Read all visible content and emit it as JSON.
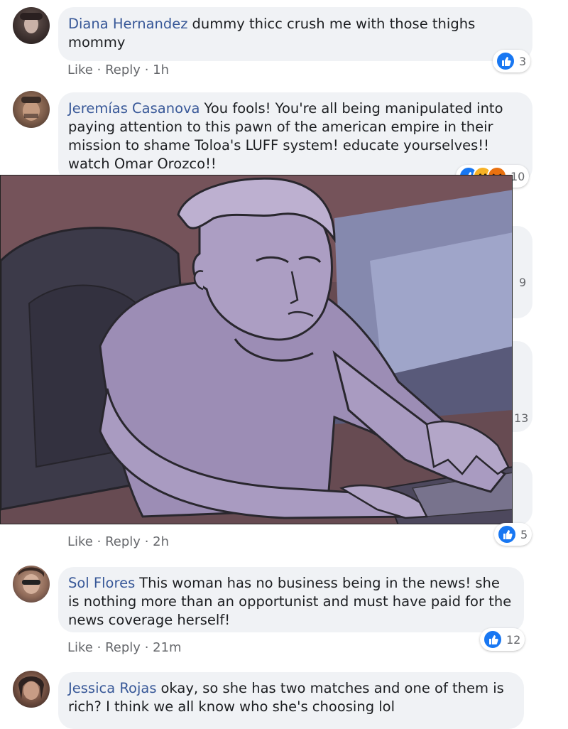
{
  "comments": [
    {
      "author": "Diana Hernandez",
      "text": "dummy thicc crush me with those thighs mommy",
      "like_label": "Like",
      "reply_label": "Reply",
      "time": "1h",
      "reaction_count": "3",
      "reaction_icons": [
        "like-icon"
      ]
    },
    {
      "author": "Jeremías Casanova",
      "text": "You fools! You're all being manipulated into paying attention to this pawn of the american empire in their mission to shame Toloa's LUFF system! educate yourselves!! watch Omar Orozco!!",
      "reaction_count": "10",
      "reaction_icons": [
        "like-icon",
        "sad-icon",
        "angry-icon"
      ]
    },
    {
      "like_label": "Like",
      "reply_label": "Reply",
      "time": "2h",
      "reaction_count": "5",
      "reaction_icons": [
        "like-icon"
      ],
      "partially_visible_counts": [
        "9",
        "13"
      ]
    },
    {
      "author": "Sol Flores",
      "text": "This woman has no business being in the news! she is nothing more than an opportunist and must have paid for the news coverage herself!",
      "like_label": "Like",
      "reply_label": "Reply",
      "time": "21m",
      "reaction_count": "12",
      "reaction_icons": [
        "like-icon"
      ]
    },
    {
      "author": "Jessica Rojas",
      "text": "okay, so she has two matches and one of them is rich? I think we all know who she's choosing lol"
    }
  ],
  "separator": "·",
  "colors": {
    "author_link": "#385898",
    "meta": "#65676b",
    "bubble": "#f0f2f5",
    "like_blue": "#1877f2",
    "sad_yellow": "#f7b125",
    "angry_orange": "#e9710f",
    "illustration_tint": "#8e7f9e"
  },
  "overlay": {
    "description_icon": "illustration-man-typing"
  }
}
